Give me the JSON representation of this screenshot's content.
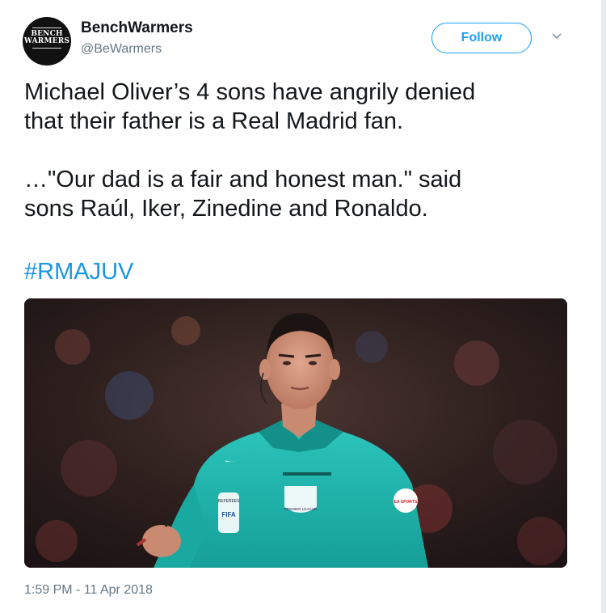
{
  "author": {
    "display_name": "BenchWarmers",
    "handle": "@BeWarmers",
    "avatar_logo_line1": "BENCH",
    "avatar_logo_line2": "WARMERS"
  },
  "follow_button_label": "Follow",
  "tweet": {
    "text_line1": "Michael Oliver’s 4 sons have angrily denied",
    "text_line2": "that their father is a Real Madrid fan.",
    "text_line3": "…\"Our dad is a fair and honest man.\" said",
    "text_line4": "sons Raúl, Iker, Zinedine and Ronaldo.",
    "hashtag": "#RMAJUV",
    "timestamp": "1:59 PM - 11 Apr 2018"
  },
  "photo": {
    "shirt_badge_referees": "REFEREES",
    "shirt_badge_fifa": "FIFA",
    "shirt_badge_premier_league": "PREMIER LEAGUE",
    "sleeve_badge": "EA SPORTS"
  },
  "colors": {
    "link_blue": "#1da1f2",
    "hashtag_blue": "#1b95e0",
    "secondary_text": "#657786",
    "primary_text": "#14171a",
    "referee_shirt": "#1fb8b0"
  }
}
